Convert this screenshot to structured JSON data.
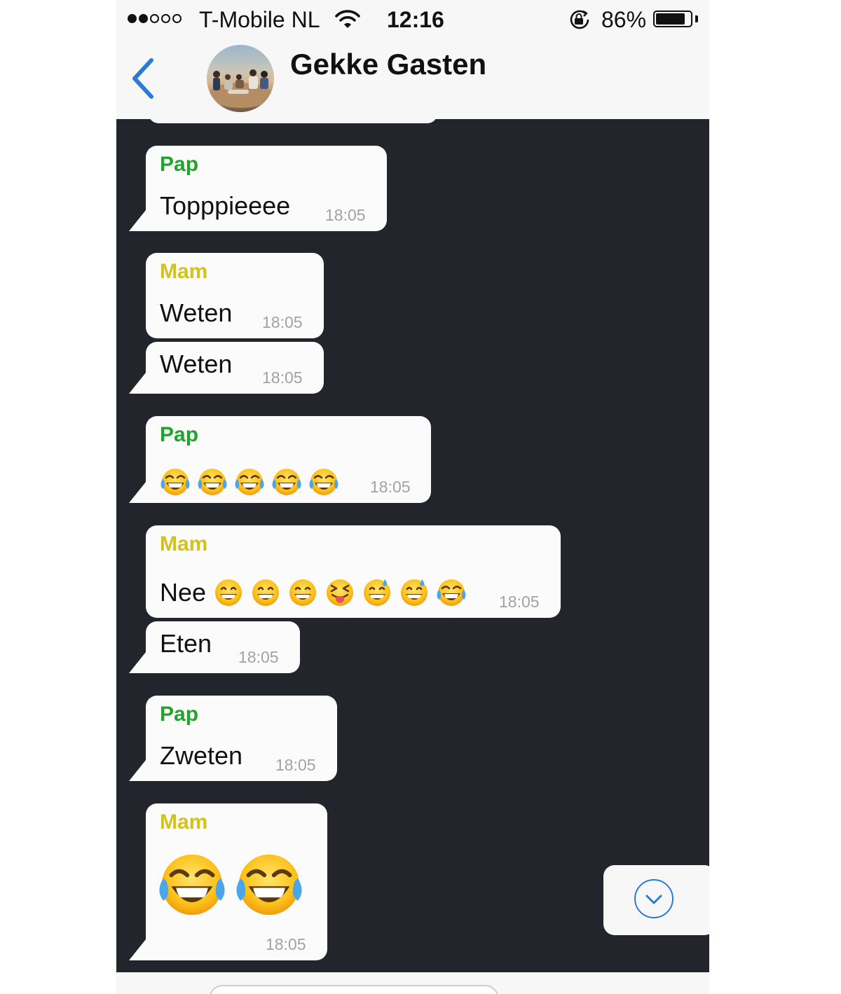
{
  "status_bar": {
    "carrier": "T-Mobile NL",
    "time": "12:16",
    "battery_percent": "86%",
    "battery_level": 0.86,
    "signal_bars": 2,
    "signal_max": 5
  },
  "header": {
    "back_icon": "chevron-left-icon",
    "title": "Gekke Gasten",
    "avatar_icon": "group-photo-avatar"
  },
  "colors": {
    "chat_background": "#22252c",
    "bubble": "#fbfbfb",
    "sender_pap": "#21a32c",
    "sender_mam": "#d2c21a",
    "accent": "#2b7bd6"
  },
  "messages": [
    {
      "sender": "Pap",
      "text": "Topppieeee",
      "time": "18:05"
    },
    {
      "sender": "Mam",
      "text": "Weten",
      "time": "18:05"
    },
    {
      "text": "Weten",
      "time": "18:05"
    },
    {
      "sender": "Pap",
      "emoji": [
        "face-with-tears-of-joy",
        "face-with-tears-of-joy",
        "face-with-tears-of-joy",
        "face-with-tears-of-joy",
        "face-with-tears-of-joy"
      ],
      "time": "18:05"
    },
    {
      "sender": "Mam",
      "text": "Nee",
      "emoji": [
        "grinning-face",
        "grinning-face",
        "grinning-face",
        "squinting-face-with-tongue",
        "grinning-face-with-sweat",
        "grinning-face-with-sweat",
        "face-with-tears-of-joy"
      ],
      "time": "18:05"
    },
    {
      "text": "Eten",
      "time": "18:05"
    },
    {
      "sender": "Pap",
      "text": "Zweten",
      "time": "18:05"
    },
    {
      "sender": "Mam",
      "emoji": [
        "face-with-tears-of-joy",
        "face-with-tears-of-joy"
      ],
      "time": "18:05"
    }
  ],
  "scroll_down": {
    "icon": "chevron-down-icon"
  }
}
